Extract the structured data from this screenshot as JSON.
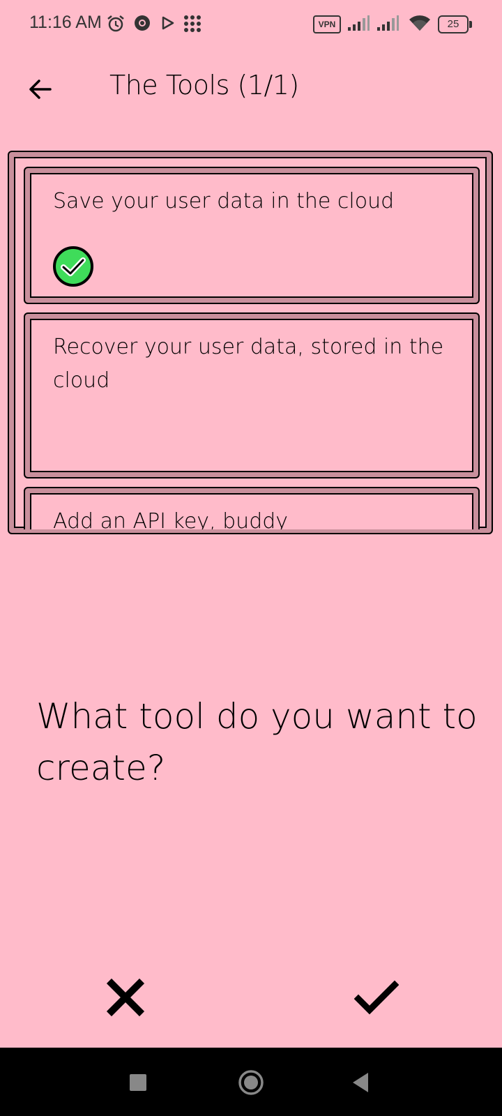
{
  "status_bar": {
    "time": "11:16 AM",
    "vpn_label": "VPN",
    "battery_level": "25",
    "icons": [
      "alarm-icon",
      "chrome-icon",
      "play-store-icon",
      "apps-grid-icon",
      "vpn-icon",
      "signal-icon",
      "signal-icon",
      "wifi-icon",
      "battery-icon"
    ]
  },
  "header": {
    "title": "The Tools (1/1)",
    "back_icon": "arrow-left-icon"
  },
  "tools": {
    "items": [
      {
        "label": "Save your user data in the cloud",
        "selected": true
      },
      {
        "label": "Recover your user data, stored in the cloud",
        "selected": false
      },
      {
        "label": "Add an API key, buddy",
        "selected": false
      }
    ]
  },
  "prompt": {
    "question": "What tool do you want to create?"
  },
  "actions": {
    "cancel_icon": "close-icon",
    "confirm_icon": "check-icon"
  },
  "nav_bar": {
    "icons": [
      "recents-square-icon",
      "home-circle-icon",
      "back-triangle-icon"
    ]
  },
  "colors": {
    "background": "#ffbbca",
    "border_shade": "#c98f9c",
    "selected_check": "#3fdc5a",
    "nav_background": "#000000"
  }
}
